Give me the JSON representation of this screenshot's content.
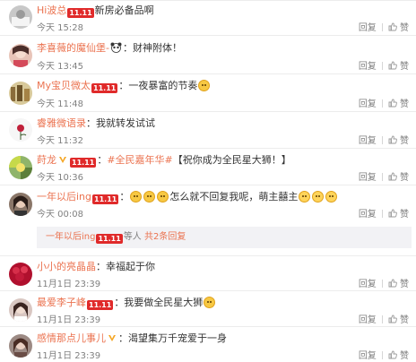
{
  "actions": {
    "reply": "回复",
    "like": "赞"
  },
  "comments": [
    {
      "username": "Hi波总",
      "badge": "11.11",
      "text": "新房必备品啊",
      "time": "今天 15:28",
      "avatar_color": "#b7b7b7"
    },
    {
      "username": "李喜薇的魔仙堡-",
      "text": "：财神附体！",
      "time": "今天 13:45",
      "avatar_color": "#e8c4b8"
    },
    {
      "username": "My宝贝微太",
      "badge": "11.11",
      "text": "：一夜暴富的节奏",
      "time": "今天 11:48",
      "avatar_color": "#c9b27a"
    },
    {
      "username": "睿雅微语录",
      "text": "：我就转发试试",
      "time": "今天 11:32",
      "avatar_color": "#f3f3f3"
    },
    {
      "username": "莳龙",
      "badge": "11.11",
      "topic": "#全民嘉年华#",
      "text": "【祝你成为全民星大狮！】",
      "time": "今天 10:36",
      "avatar_color": "#7a9f5c"
    },
    {
      "username": "一年以后ing",
      "badge": "11.11",
      "text": "怎么就不回复我呢，萌主囍主",
      "time": "今天 00:08",
      "avatar_color": "#6b5a4e"
    },
    {
      "username": "小小的亮晶晶",
      "text": "：幸福起于你",
      "time": "11月1日 23:39",
      "avatar_color": "#b9123a"
    },
    {
      "username": "最爱李子峰",
      "badge": "11.11",
      "text": "：我要做全民星大狮",
      "time": "11月1日 23:39",
      "avatar_color": "#c8b3ad"
    },
    {
      "username": "感情那点儿事儿",
      "text": "：渴望集万千宠爱于一身",
      "time": "11月1日 23:39",
      "avatar_color": "#8b7b76"
    }
  ],
  "subreply": {
    "username": "一年以后ing",
    "badge": "11.11",
    "middle": "等人",
    "link": "共2条回复"
  }
}
